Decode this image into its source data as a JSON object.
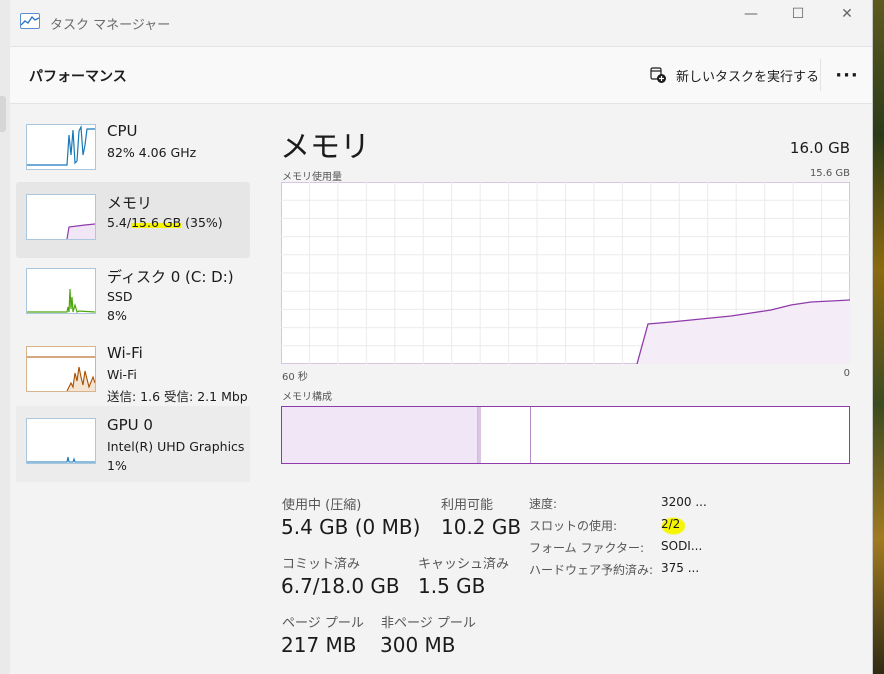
{
  "window": {
    "title": "タスク マネージャー",
    "minimize_glyph": "—",
    "maximize_glyph": "☐",
    "close_glyph": "✕",
    "app_icon": "task-manager-icon"
  },
  "header": {
    "title": "パフォーマンス",
    "run_task_label": "新しいタスクを実行する",
    "run_task_icon": "new-task-icon",
    "more_glyph": "···"
  },
  "sidebar": {
    "items": [
      {
        "title": "CPU",
        "line1": "82% 4.06 GHz",
        "line2": "",
        "color": "#1778b9"
      },
      {
        "title": "メモリ",
        "line1_prefix": "5.4/",
        "line1_highlight": "15.6 GB",
        "line1_suffix": " (35%)",
        "color": "#8f3bab"
      },
      {
        "title": "ディスク 0 (C: D:)",
        "line1": "SSD",
        "line2": "8%",
        "color": "#4da60c"
      },
      {
        "title": "Wi-Fi",
        "line1": "Wi-Fi",
        "line2": "送信: 1.6  受信: 2.1 Mbp",
        "color": "#a74f01"
      },
      {
        "title": "GPU 0",
        "line1": "Intel(R) UHD Graphics",
        "line2": "1%",
        "color": "#1778b9"
      }
    ]
  },
  "main": {
    "title": "メモリ",
    "total": "16.0 GB",
    "usage_label": "メモリ使用量",
    "usage_max": "15.6 GB",
    "time_left": "60 秒",
    "time_right": "0",
    "composition_label": "メモリ構成",
    "accent": "#8f3bab"
  },
  "stats": {
    "in_use_label": "使用中 (圧縮)",
    "in_use_value": "5.4 GB (0 MB)",
    "available_label": "利用可能",
    "available_value": "10.2 GB",
    "committed_label": "コミット済み",
    "committed_value": "6.7/18.0 GB",
    "cached_label": "キャッシュ済み",
    "cached_value": "1.5 GB",
    "paged_label": "ページ プール",
    "paged_value": "217 MB",
    "nonpaged_label": "非ページ プール",
    "nonpaged_value": "300 MB"
  },
  "specs": {
    "speed_label": "速度:",
    "speed_value": "3200 ...",
    "slots_label": "スロットの使用:",
    "slots_value": "2/2",
    "form_label": "フォーム ファクター:",
    "form_value": "SODI...",
    "reserved_label": "ハードウェア予約済み:",
    "reserved_value": "375 ..."
  },
  "highlight_color": "#f6f600"
}
